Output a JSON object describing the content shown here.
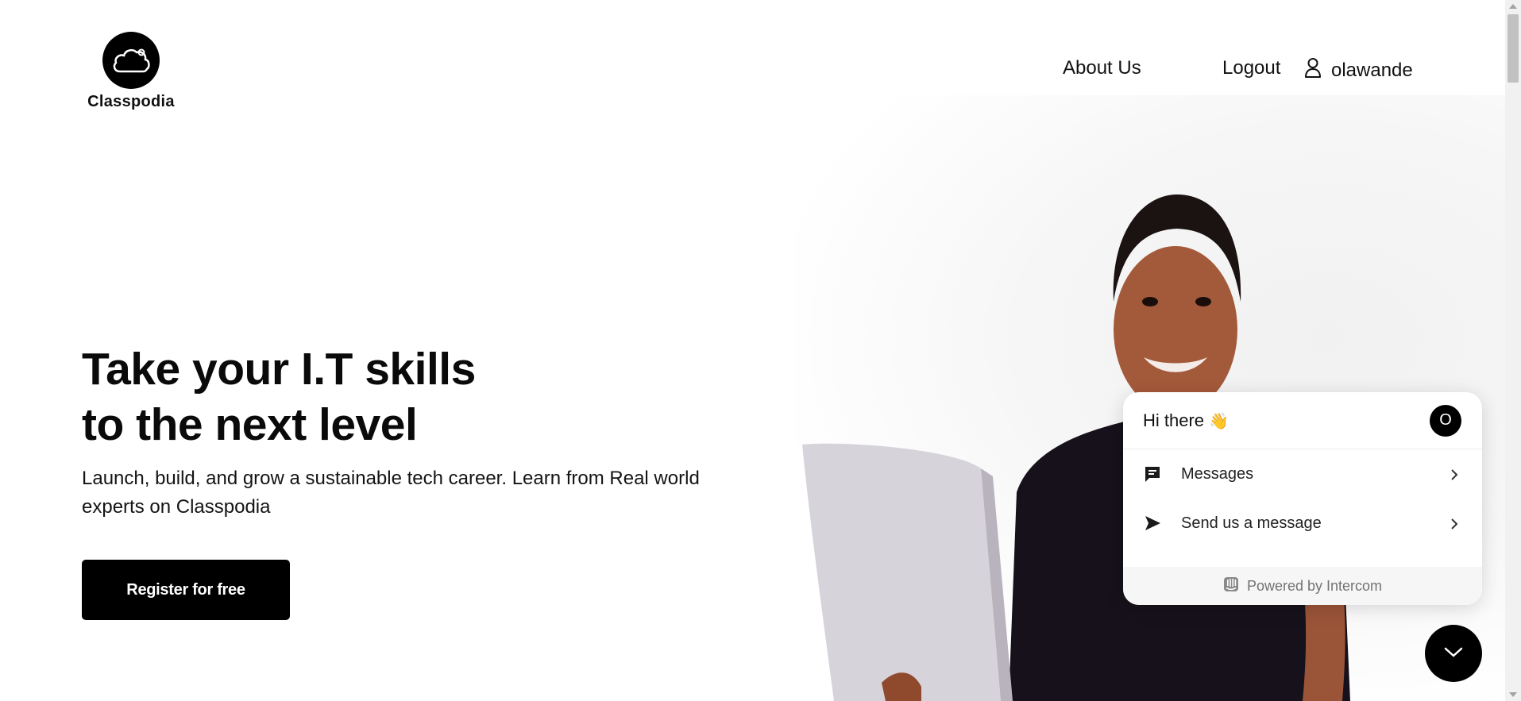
{
  "header": {
    "logo_text": "Classpodia",
    "nav": {
      "about": "About Us",
      "logout": "Logout",
      "username": "olawande"
    }
  },
  "hero": {
    "title_line1": "Take your I.T skills",
    "title_line2": "to the next level",
    "subtitle": "Launch, build, and grow a sustainable tech career. Learn from Real world experts on Classpodia",
    "cta_label": "Register for free"
  },
  "chat_widget": {
    "greeting": "Hi there",
    "greeting_emoji": "👋",
    "avatar_letter": "O",
    "items": [
      {
        "label": "Messages",
        "icon": "message-icon"
      },
      {
        "label": "Send us a message",
        "icon": "send-icon"
      }
    ],
    "footer": "Powered by Intercom"
  },
  "colors": {
    "primary": "#000000",
    "background": "#ffffff",
    "chat_footer_bg": "#f6f6f6"
  }
}
